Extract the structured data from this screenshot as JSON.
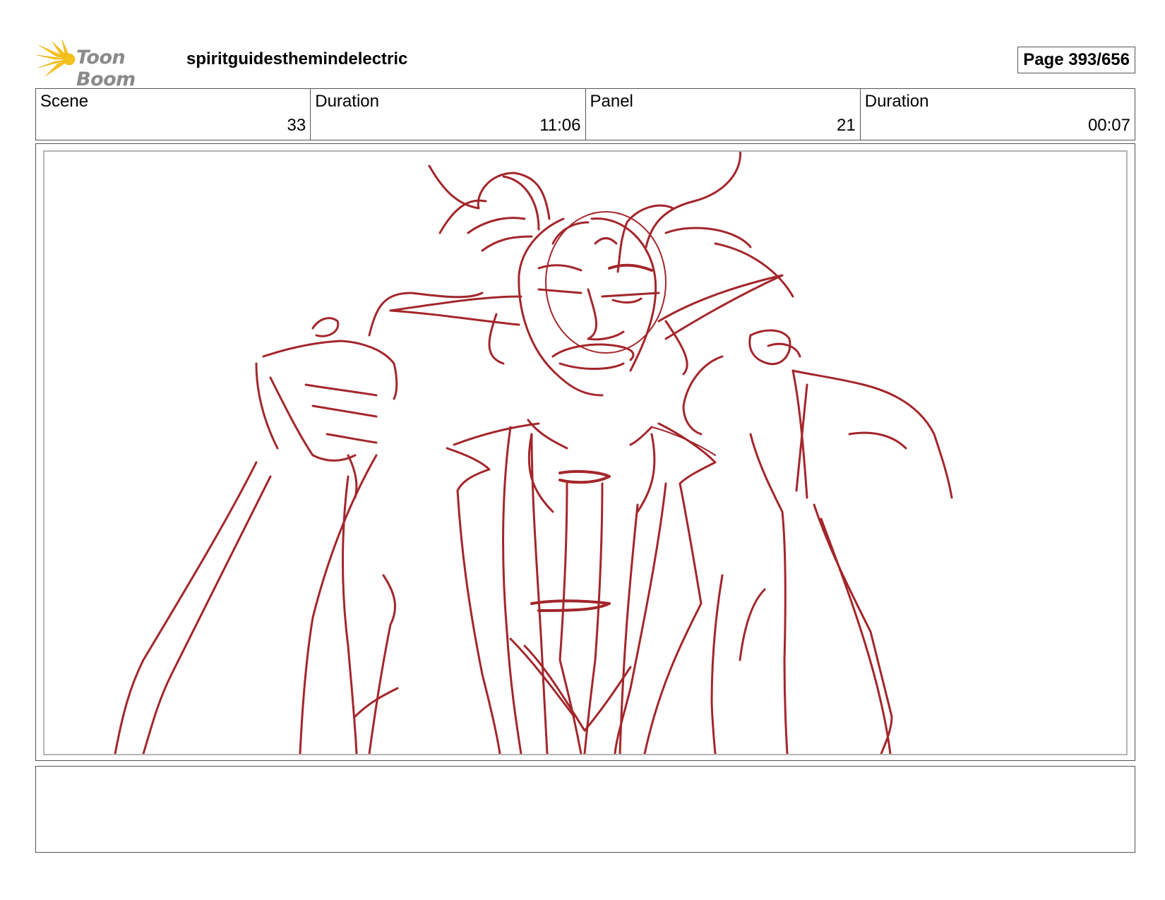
{
  "header": {
    "logo_text": "Toon Boom",
    "project_title": "spiritguidesthemindelectric",
    "page_label": "Page 393/656"
  },
  "info": {
    "scene_label": "Scene",
    "scene_value": "33",
    "scene_duration_label": "Duration",
    "scene_duration_value": "11:06",
    "panel_label": "Panel",
    "panel_value": "21",
    "panel_duration_label": "Duration",
    "panel_duration_value": "00:07"
  },
  "colors": {
    "sketch": "#a3262b",
    "logo_yellow": "#f5c21b",
    "logo_text": "#8a8a8a"
  },
  "panel": {
    "image": "storyboard-sketch-horned-character"
  },
  "notes": {
    "text": ""
  }
}
